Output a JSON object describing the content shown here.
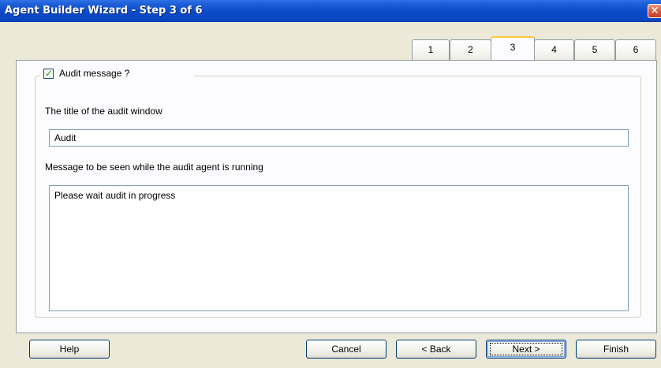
{
  "window": {
    "title": "Agent Builder Wizard - Step 3 of 6",
    "close_glyph": "×"
  },
  "tabs": [
    {
      "label": "1",
      "active": false
    },
    {
      "label": "2",
      "active": false
    },
    {
      "label": "3",
      "active": true
    },
    {
      "label": "4",
      "active": false
    },
    {
      "label": "5",
      "active": false
    },
    {
      "label": "6",
      "active": false
    }
  ],
  "group": {
    "checkbox_label": "Audit message ?",
    "checked": true,
    "check_glyph": "✓"
  },
  "title_field": {
    "label": "The title of the audit window",
    "value": "Audit"
  },
  "message_field": {
    "label": "Message to be seen while the audit agent is running",
    "value": "Please wait audit in progress"
  },
  "buttons": {
    "help": "Help",
    "cancel": "Cancel",
    "back": "< Back",
    "next": "Next >",
    "finish": "Finish"
  },
  "colors": {
    "titlebar": "#0a49c9",
    "window_bg": "#ece9d8",
    "active_tab_accent": "#ffc83c",
    "button_border": "#003c74",
    "check_mark": "#21a121"
  }
}
